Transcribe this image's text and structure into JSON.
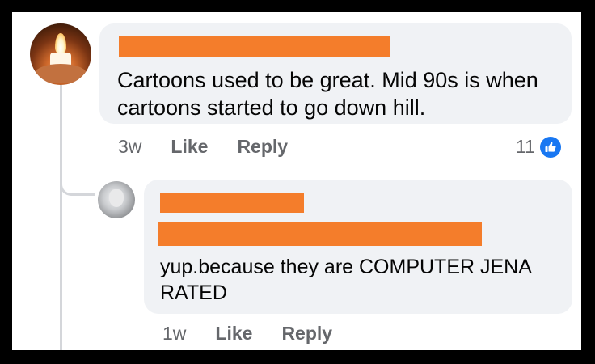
{
  "comments": [
    {
      "text": "Cartoons used to be great. Mid 90s is when cartoons started to go down hill.",
      "time": "3w",
      "like_label": "Like",
      "reply_label": "Reply",
      "reaction_count": "11",
      "avatar_icon": "candle-avatar"
    }
  ],
  "replies": [
    {
      "text": "yup.because they are COMPUTER JENA RATED",
      "time": "1w",
      "like_label": "Like",
      "reply_label": "Reply",
      "avatar_icon": "user-avatar"
    }
  ],
  "colors": {
    "redaction": "#f47d2b",
    "bubble": "#f0f2f5",
    "like_blue": "#1877f2",
    "meta_gray": "#65676b"
  }
}
